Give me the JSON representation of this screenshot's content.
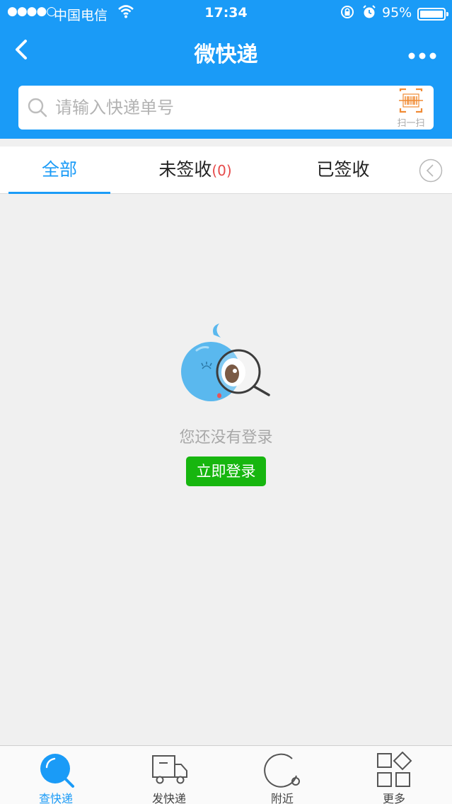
{
  "status_bar": {
    "signal": "●●●●○",
    "carrier": "中国电信",
    "time": "17:34",
    "battery_percent": "95%",
    "icons": [
      "wifi-icon",
      "rotation-lock-icon",
      "alarm-icon",
      "battery-icon"
    ]
  },
  "nav": {
    "title": "微快递",
    "back_icon": "chevron-left-icon",
    "more_icon": "more-dots-icon"
  },
  "search": {
    "placeholder": "请输入快递单号",
    "value": "",
    "scan_label": "扫一扫",
    "scan_icon": "barcode-scan-icon"
  },
  "tabs": [
    {
      "label": "全部",
      "active": true
    },
    {
      "label": "未签收",
      "count": "(0)"
    },
    {
      "label": "已签收"
    }
  ],
  "empty_state": {
    "message": "您还没有登录",
    "button_label": "立即登录",
    "illustration": "mascot-magnifier-icon"
  },
  "tabbar": [
    {
      "label": "查快递",
      "icon": "search-icon",
      "active": true
    },
    {
      "label": "发快递",
      "icon": "truck-icon"
    },
    {
      "label": "附近",
      "icon": "nearby-icon"
    },
    {
      "label": "更多",
      "icon": "grid-icon"
    }
  ],
  "colors": {
    "brand_blue": "#1a9bf7",
    "login_green": "#17b60f",
    "count_red": "#e64a4a",
    "background": "#f0f0f0"
  }
}
